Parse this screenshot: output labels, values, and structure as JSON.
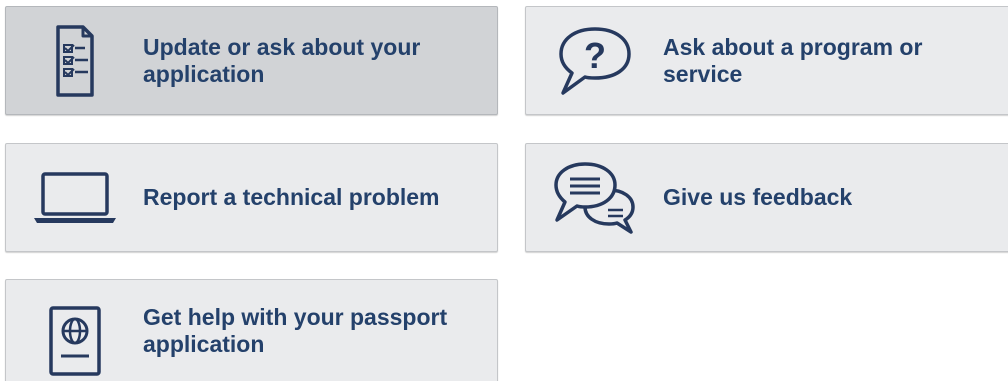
{
  "cards": [
    {
      "label": "Update or ask about your application",
      "icon": "checklist-document-icon",
      "active": true
    },
    {
      "label": "Ask about a program or service",
      "icon": "question-speech-bubble-icon",
      "active": false
    },
    {
      "label": "Report a technical problem",
      "icon": "laptop-icon",
      "active": false
    },
    {
      "label": "Give us feedback",
      "icon": "chat-bubbles-icon",
      "active": false
    },
    {
      "label": "Get help with your passport application",
      "icon": "passport-icon",
      "active": false
    }
  ],
  "colors": {
    "icon_navy": "#26395e",
    "text_navy": "#24416b",
    "card_bg": "#eaebed",
    "card_active_bg": "#d1d3d6"
  }
}
